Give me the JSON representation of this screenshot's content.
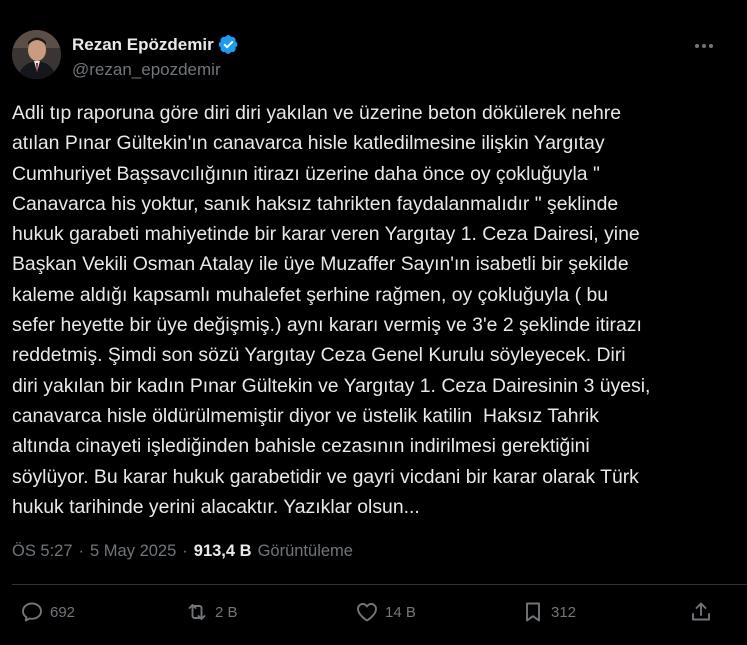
{
  "author": {
    "name": "Rezan Epözdemir",
    "handle": "@rezan_epozdemir"
  },
  "tweet": {
    "text": "Adli tıp raporuna göre diri diri yakılan ve üzerine beton dökülerek nehre\natılan Pınar Gültekin'ın canavarca hisle katledilmesine ilişkin Yargıtay\nCumhuriyet Başsavcılığının itirazı üzerine daha önce oy çokluğuyla \"\nCanavarca his yoktur, sanık haksız tahrikten faydalanmalıdır \" şeklinde\nhukuk garabeti mahiyetinde bir karar veren Yargıtay 1. Ceza Dairesi, yine\nBaşkan Vekili Osman Atalay ile üye Muzaffer Sayın'ın isabetli bir şekilde\nkaleme aldığı kapsamlı muhalefet şerhine rağmen, oy çokluğuyla ( bu\nsefer heyette bir üye değişmiş.) aynı kararı vermiş ve 3'e 2 şeklinde itirazı\nreddetmiş. Şimdi son sözü Yargıtay Ceza Genel Kurulu söyleyecek. Diri\ndiri yakılan bir kadın Pınar Gültekin ve Yargıtay 1. Ceza Dairesinin 3 üyesi,\ncanavarca hisle öldürülmemiştir diyor ve üstelik katilin  Haksız Tahrik\naltında cinayeti işlediğinden bahisle cezasının indirilmesi gerektiğini\nsöylüyor. Bu karar hukuk garabetidir ve gayri vicdani bir karar olarak Türk\nhukuk tarihinde yerini alacaktır. Yazıklar olsun...",
    "time": "ÖS 5:27",
    "date": "5 May 2025",
    "separator": "·",
    "views_count": "913,4 B",
    "views_label": "Görüntüleme"
  },
  "actions": {
    "replies": "692",
    "retweets": "2 B",
    "likes": "14 B",
    "bookmarks": "312"
  },
  "icons": {
    "verified": "verified-badge-icon",
    "more": "more-dots-icon",
    "reply": "reply-icon",
    "retweet": "retweet-icon",
    "like": "heart-icon",
    "bookmark": "bookmark-icon",
    "share": "share-icon"
  },
  "colors": {
    "background": "#000000",
    "text": "#e7e9ea",
    "muted": "#71767b",
    "verified": "#1d9bf0"
  }
}
